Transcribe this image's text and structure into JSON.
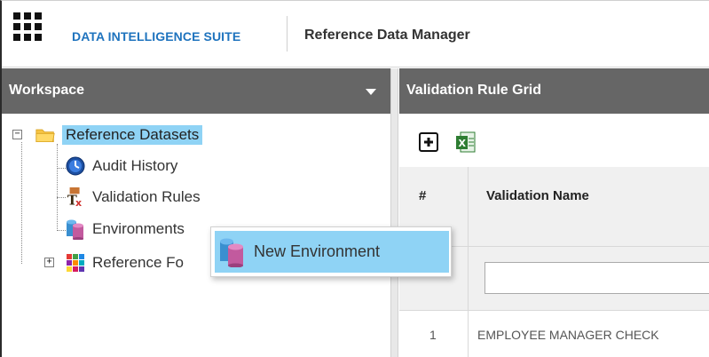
{
  "header": {
    "suite_title": "DATA INTELLIGENCE SUITE",
    "module_title": "Reference Data Manager"
  },
  "workspace": {
    "title": "Workspace",
    "tree": [
      {
        "label": "Reference Datasets",
        "icon": "folder-icon",
        "selected": true,
        "expanded": true
      },
      {
        "label": "Audit History",
        "icon": "clock-icon"
      },
      {
        "label": "Validation Rules",
        "icon": "tx-rules-icon"
      },
      {
        "label": "Environments",
        "icon": "database-icon"
      },
      {
        "label": "Reference Fo",
        "icon": "grid-colors-icon",
        "expanded": false
      }
    ]
  },
  "context_menu": {
    "items": [
      {
        "label": "New Environment",
        "icon": "database-icon"
      }
    ]
  },
  "grid": {
    "title": "Validation Rule Grid",
    "toolbar": {
      "add_icon": "add-icon",
      "export_icon": "excel-export-icon"
    },
    "columns": [
      "#",
      "Validation Name"
    ],
    "filter_value": "",
    "rows": [
      {
        "num": "1",
        "name": "EMPLOYEE MANAGER CHECK"
      }
    ]
  },
  "colors": {
    "header_bg": "#666666",
    "brand_blue": "#1e73be",
    "selection": "#8fd3f5"
  }
}
